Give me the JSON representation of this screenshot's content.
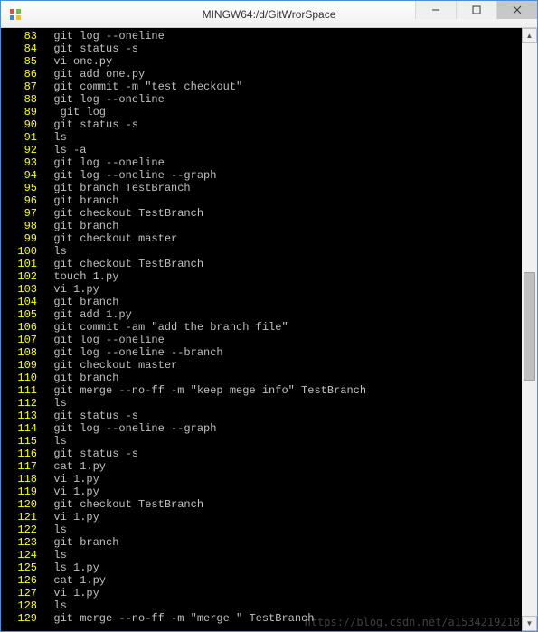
{
  "window": {
    "title": "MINGW64:/d/GitWrorSpace"
  },
  "watermark": "https://blog.csdn.net/a1534219218",
  "lines": [
    {
      "n": "83",
      "t": "git log --oneline"
    },
    {
      "n": "84",
      "t": "git status -s"
    },
    {
      "n": "85",
      "t": "vi one.py"
    },
    {
      "n": "86",
      "t": "git add one.py"
    },
    {
      "n": "87",
      "t": "git commit -m \"test checkout\""
    },
    {
      "n": "88",
      "t": "git log --oneline"
    },
    {
      "n": "89",
      "t": " git log"
    },
    {
      "n": "90",
      "t": "git status -s"
    },
    {
      "n": "91",
      "t": "ls"
    },
    {
      "n": "92",
      "t": "ls -a"
    },
    {
      "n": "93",
      "t": "git log --oneline"
    },
    {
      "n": "94",
      "t": "git log --oneline --graph"
    },
    {
      "n": "95",
      "t": "git branch TestBranch"
    },
    {
      "n": "96",
      "t": "git branch"
    },
    {
      "n": "97",
      "t": "git checkout TestBranch"
    },
    {
      "n": "98",
      "t": "git branch"
    },
    {
      "n": "99",
      "t": "git checkout master"
    },
    {
      "n": "100",
      "t": "ls"
    },
    {
      "n": "101",
      "t": "git checkout TestBranch"
    },
    {
      "n": "102",
      "t": "touch 1.py"
    },
    {
      "n": "103",
      "t": "vi 1.py"
    },
    {
      "n": "104",
      "t": "git branch"
    },
    {
      "n": "105",
      "t": "git add 1.py"
    },
    {
      "n": "106",
      "t": "git commit -am \"add the branch file\""
    },
    {
      "n": "107",
      "t": "git log --oneline"
    },
    {
      "n": "108",
      "t": "git log --oneline --branch"
    },
    {
      "n": "109",
      "t": "git checkout master"
    },
    {
      "n": "110",
      "t": "git branch"
    },
    {
      "n": "111",
      "t": "git merge --no-ff -m \"keep mege info\" TestBranch"
    },
    {
      "n": "112",
      "t": "ls"
    },
    {
      "n": "113",
      "t": "git status -s"
    },
    {
      "n": "114",
      "t": "git log --oneline --graph"
    },
    {
      "n": "115",
      "t": "ls"
    },
    {
      "n": "116",
      "t": "git status -s"
    },
    {
      "n": "117",
      "t": "cat 1.py"
    },
    {
      "n": "118",
      "t": "vi 1.py"
    },
    {
      "n": "119",
      "t": "vi 1.py"
    },
    {
      "n": "120",
      "t": "git checkout TestBranch"
    },
    {
      "n": "121",
      "t": "vi 1.py"
    },
    {
      "n": "122",
      "t": "ls"
    },
    {
      "n": "123",
      "t": "git branch"
    },
    {
      "n": "124",
      "t": "ls"
    },
    {
      "n": "125",
      "t": "ls 1.py"
    },
    {
      "n": "126",
      "t": "cat 1.py"
    },
    {
      "n": "127",
      "t": "vi 1.py"
    },
    {
      "n": "128",
      "t": "ls"
    },
    {
      "n": "129",
      "t": "git merge --no-ff -m \"merge \" TestBranch"
    }
  ]
}
